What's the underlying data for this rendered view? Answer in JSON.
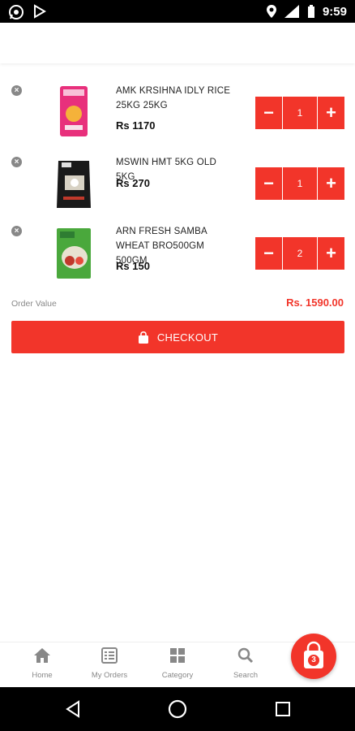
{
  "status_bar": {
    "time": "9:59"
  },
  "cart": {
    "items": [
      {
        "name": "AMK KRSIHNA IDLY RICE 25KG 25KG",
        "price": "Rs 1170",
        "qty": "1",
        "thumb_color": "#e8307c"
      },
      {
        "name": "MSWIN HMT 5KG OLD 5KG",
        "price": "Rs 270",
        "qty": "1",
        "thumb_color": "#1a1a1a"
      },
      {
        "name": "ARN FRESH SAMBA WHEAT BRO500GM 500GM",
        "price": "Rs 150",
        "qty": "2",
        "thumb_color": "#4aa83c"
      }
    ],
    "minus_label": "−",
    "plus_label": "+",
    "remove_label": "×"
  },
  "summary": {
    "order_label": "Order Value",
    "order_value": "Rs. 1590.00"
  },
  "checkout": {
    "label": "CHECKOUT"
  },
  "bottom_nav": {
    "home": "Home",
    "orders": "My Orders",
    "category": "Category",
    "search": "Search"
  },
  "cart_fab": {
    "count": "3"
  },
  "colors": {
    "accent": "#f2352a"
  }
}
